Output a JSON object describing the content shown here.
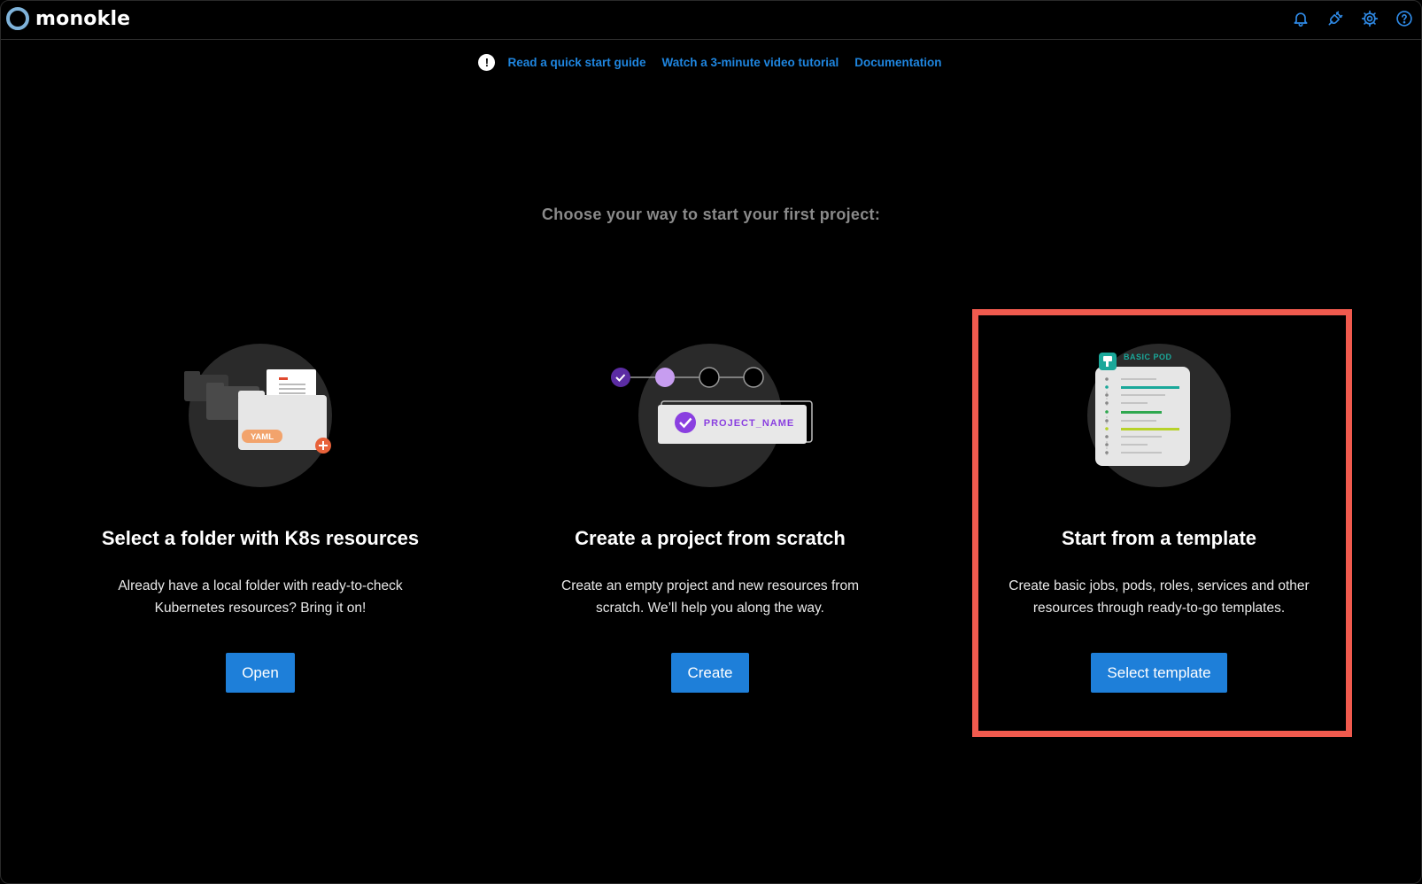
{
  "app": {
    "name": "monokle"
  },
  "header": {
    "icons": [
      "bell-icon",
      "plug-icon",
      "gear-icon",
      "help-circle-icon"
    ]
  },
  "help_links": {
    "quick_start": "Read a quick start guide",
    "video": "Watch a 3-minute video tutorial",
    "docs": "Documentation"
  },
  "subtitle": "Choose your way to start your first project:",
  "cards": [
    {
      "title": "Select a folder with K8s resources",
      "description": "Already have a local folder with ready-to-check Kubernetes resources? Bring it on!",
      "button": "Open",
      "badge": "YAML"
    },
    {
      "title": "Create a project from scratch",
      "description": "Create an empty project and new resources from scratch. We’ll help you along the way.",
      "button": "Create",
      "badge": "PROJECT_NAME"
    },
    {
      "title": "Start from a template",
      "description": "Create basic jobs, pods, roles, services and other resources through ready-to-go templates.",
      "button": "Select template",
      "badge": "BASIC POD"
    }
  ],
  "colors": {
    "accent": "#1e7fd9",
    "highlight": "#f05a4e",
    "link": "#1f86e0"
  }
}
